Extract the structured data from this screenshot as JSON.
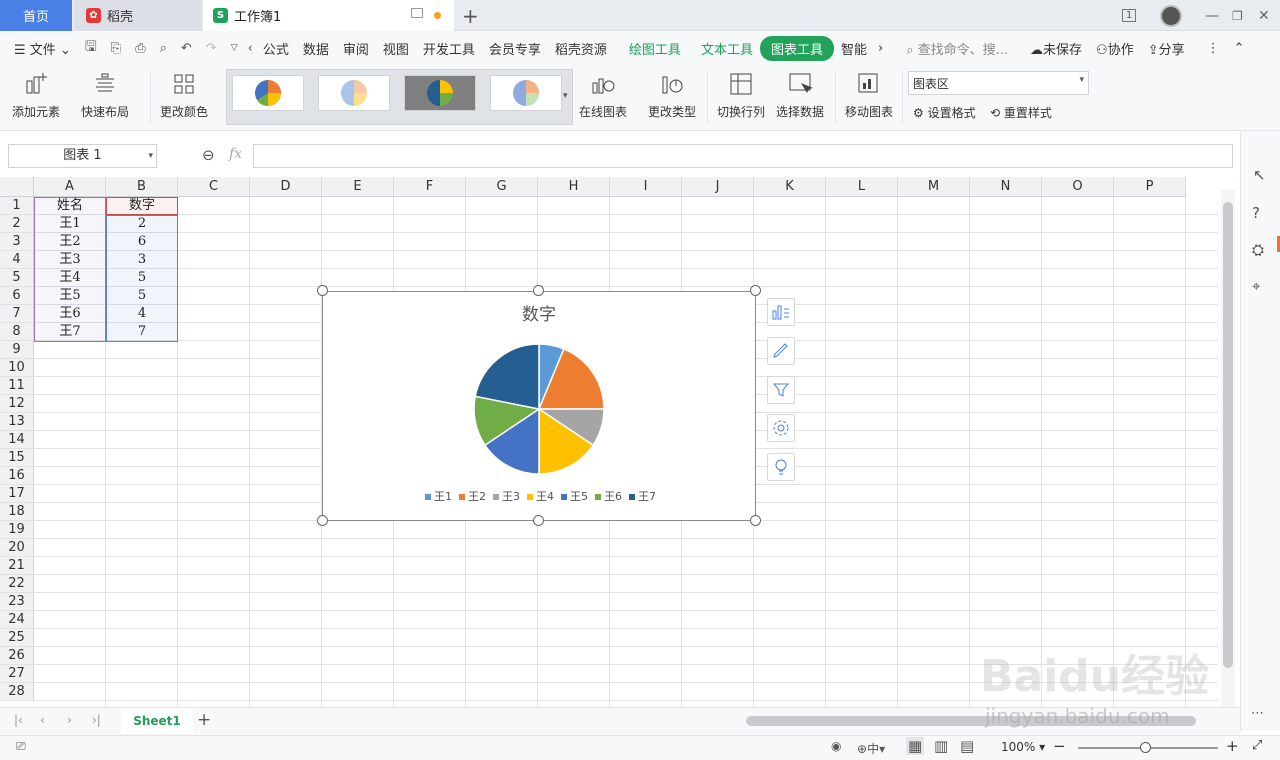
{
  "tabs": {
    "home": "首页",
    "daoke": "稻壳",
    "workbook": "工作簿1"
  },
  "menu": {
    "file": "文件",
    "items": [
      "公式",
      "数据",
      "审阅",
      "视图",
      "开发工具",
      "会员专享",
      "稻壳资源"
    ],
    "tool_tabs": [
      "绘图工具",
      "文本工具"
    ],
    "active_tab": "图表工具",
    "smart": "智能",
    "search_placeholder": "查找命令、搜...",
    "unsaved": "未保存",
    "collab": "协作",
    "share": "分享"
  },
  "ribbon": {
    "add_element": "添加元素",
    "quick_layout": "快速布局",
    "change_color": "更改颜色",
    "online_chart": "在线图表",
    "change_type": "更改类型",
    "switch_row_col": "切换行列",
    "select_data": "选择数据",
    "move_chart": "移动图表",
    "chart_area_select": "图表区",
    "set_format": "设置格式",
    "reset_style": "重置样式"
  },
  "formula": {
    "name_box": "图表 1",
    "fx": "fx"
  },
  "columns": [
    "A",
    "B",
    "C",
    "D",
    "E",
    "F",
    "G",
    "H",
    "I",
    "J",
    "K",
    "L",
    "M",
    "N",
    "O",
    "P"
  ],
  "rows": [
    "1",
    "2",
    "3",
    "4",
    "5",
    "6",
    "7",
    "8",
    "9",
    "10",
    "11",
    "12",
    "13",
    "14",
    "15",
    "16",
    "17",
    "18",
    "19",
    "20",
    "21",
    "22",
    "23",
    "24",
    "25",
    "26",
    "27",
    "28"
  ],
  "cells": {
    "header_name": "姓名",
    "header_value": "数字",
    "names": [
      "王1",
      "王2",
      "王3",
      "王4",
      "王5",
      "王6",
      "王7"
    ],
    "values": [
      "2",
      "6",
      "3",
      "5",
      "5",
      "4",
      "7"
    ]
  },
  "chart_data": {
    "type": "pie",
    "title": "数字",
    "categories": [
      "王1",
      "王2",
      "王3",
      "王4",
      "王5",
      "王6",
      "王7"
    ],
    "values": [
      2,
      6,
      3,
      5,
      5,
      4,
      7
    ],
    "colors": [
      "#5b9bd5",
      "#ed7d31",
      "#a5a5a5",
      "#ffc000",
      "#4472c4",
      "#70ad47",
      "#255e91"
    ],
    "legend": "bottom"
  },
  "sheets": {
    "active": "Sheet1"
  },
  "status": {
    "zoom": "100%",
    "input_mode": "中"
  },
  "watermark": {
    "line1": "Baidu经验",
    "line2": "jingyan.baidu.com"
  }
}
